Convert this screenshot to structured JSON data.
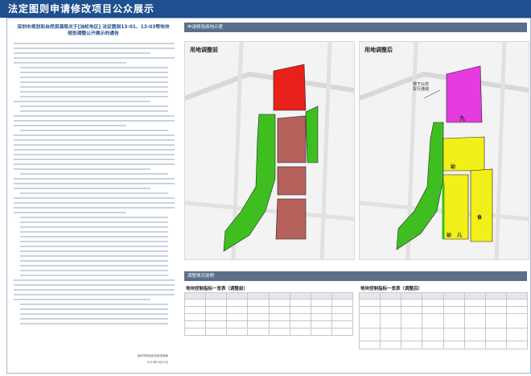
{
  "header": {
    "title": "法定图则申请修改项目公众展示"
  },
  "notice": {
    "title_line1": "深圳市规划和自然资源局关于[油松地区] 法定图则13-01、13-03等地块",
    "title_line2": "规划调整公开展示的通告",
    "signature": "深圳市规划和自然资源局",
    "date": "2019年7月23日"
  },
  "sections": {
    "map_header": "申请修改用地示意",
    "table_header": "调整情况说明"
  },
  "maps": {
    "before_label": "用地调整前",
    "after_label": "用地调整后",
    "after_callout_line1": "地下公共",
    "after_callout_line2": "车行通道",
    "after_parcel_text_a": "九",
    "after_parcel_text_b": "幼",
    "after_parcel_text_c": "幼",
    "after_parcel_text_d": "儿",
    "after_parcel_text_e": "食"
  },
  "tables": {
    "before_title": "地块控制指标一览表（调整前）",
    "after_title": "地块控制指标一览表（调整后）"
  },
  "colors": {
    "header": "#1e4f8e",
    "residential_red": "#e8201a",
    "commercial_brown": "#b5615c",
    "green": "#3fbf1f",
    "magenta": "#e53be0",
    "yellow": "#f3ef19"
  }
}
